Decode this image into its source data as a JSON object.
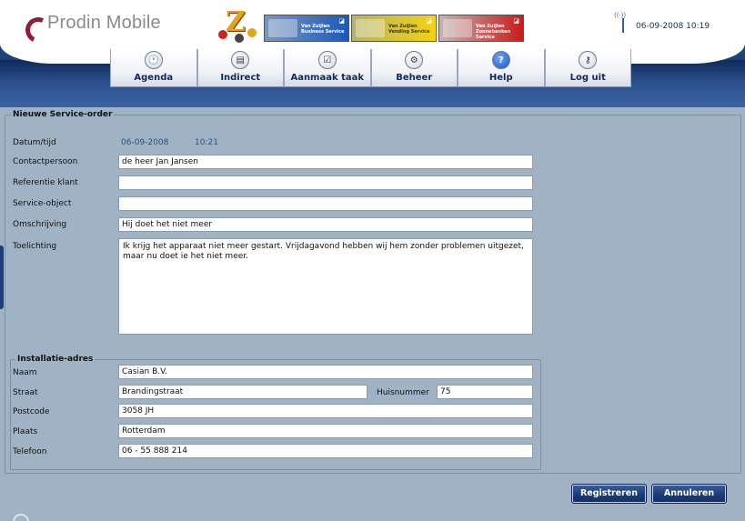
{
  "header": {
    "logo_text": "Prodin Mobile",
    "datetime": "06-09-2008 10:19",
    "banner_tiles": [
      {
        "label": "Van Zuijlen Business Service"
      },
      {
        "label": "Van Zuijlen Vending Service"
      },
      {
        "label": "Van Zuijlen Zonnebanken Service"
      }
    ]
  },
  "nav": {
    "items": [
      {
        "label": "Agenda",
        "icon": "clock-icon",
        "glyph": "🕐"
      },
      {
        "label": "Indirect",
        "icon": "document-icon",
        "glyph": "▤"
      },
      {
        "label": "Aanmaak taak",
        "icon": "checklist-icon",
        "glyph": "☑"
      },
      {
        "label": "Beheer",
        "icon": "gear-icon",
        "glyph": "⚙"
      },
      {
        "label": "Help",
        "icon": "help-icon",
        "glyph": "?"
      },
      {
        "label": "Log uit",
        "icon": "key-icon",
        "glyph": "⚷"
      }
    ]
  },
  "form": {
    "legend": "Nieuwe Service-order",
    "datum_label": "Datum/tijd",
    "datum_date": "06-09-2008",
    "datum_time": "10:21",
    "contact_label": "Contactpersoon",
    "contact_value": "de heer Jan Jansen",
    "referentie_label": "Referentie klant",
    "referentie_value": "",
    "object_label": "Service-object",
    "object_value": "",
    "omschrijving_label": "Omschrijving",
    "omschrijving_value": "Hij doet het niet meer",
    "toelichting_label": "Toelichting",
    "toelichting_line1": "Ik krijg het apparaat niet meer gestart. Vrijdagavond hebben wij hem zonder problemen uitgezet,",
    "toelichting_line2": "maar nu doet ie het niet meer."
  },
  "address": {
    "legend": "Installatie-adres",
    "naam_label": "Naam",
    "naam_value": "Casian B.V.",
    "straat_label": "Straat",
    "straat_value": "Brandingstraat",
    "huisnummer_label": "Huisnummer",
    "huisnummer_value": "75",
    "postcode_label": "Postcode",
    "postcode_value": "3058 JH",
    "plaats_label": "Plaats",
    "plaats_value": "Rotterdam",
    "telefoon_label": "Telefoon",
    "telefoon_value": "06 - 55 888 214"
  },
  "buttons": {
    "register": "Registreren",
    "cancel": "Annuleren"
  },
  "colors": {
    "header_blue": "#1e3f78",
    "page_bg": "#9fb3c4",
    "button_blue": "#1b3c79"
  }
}
